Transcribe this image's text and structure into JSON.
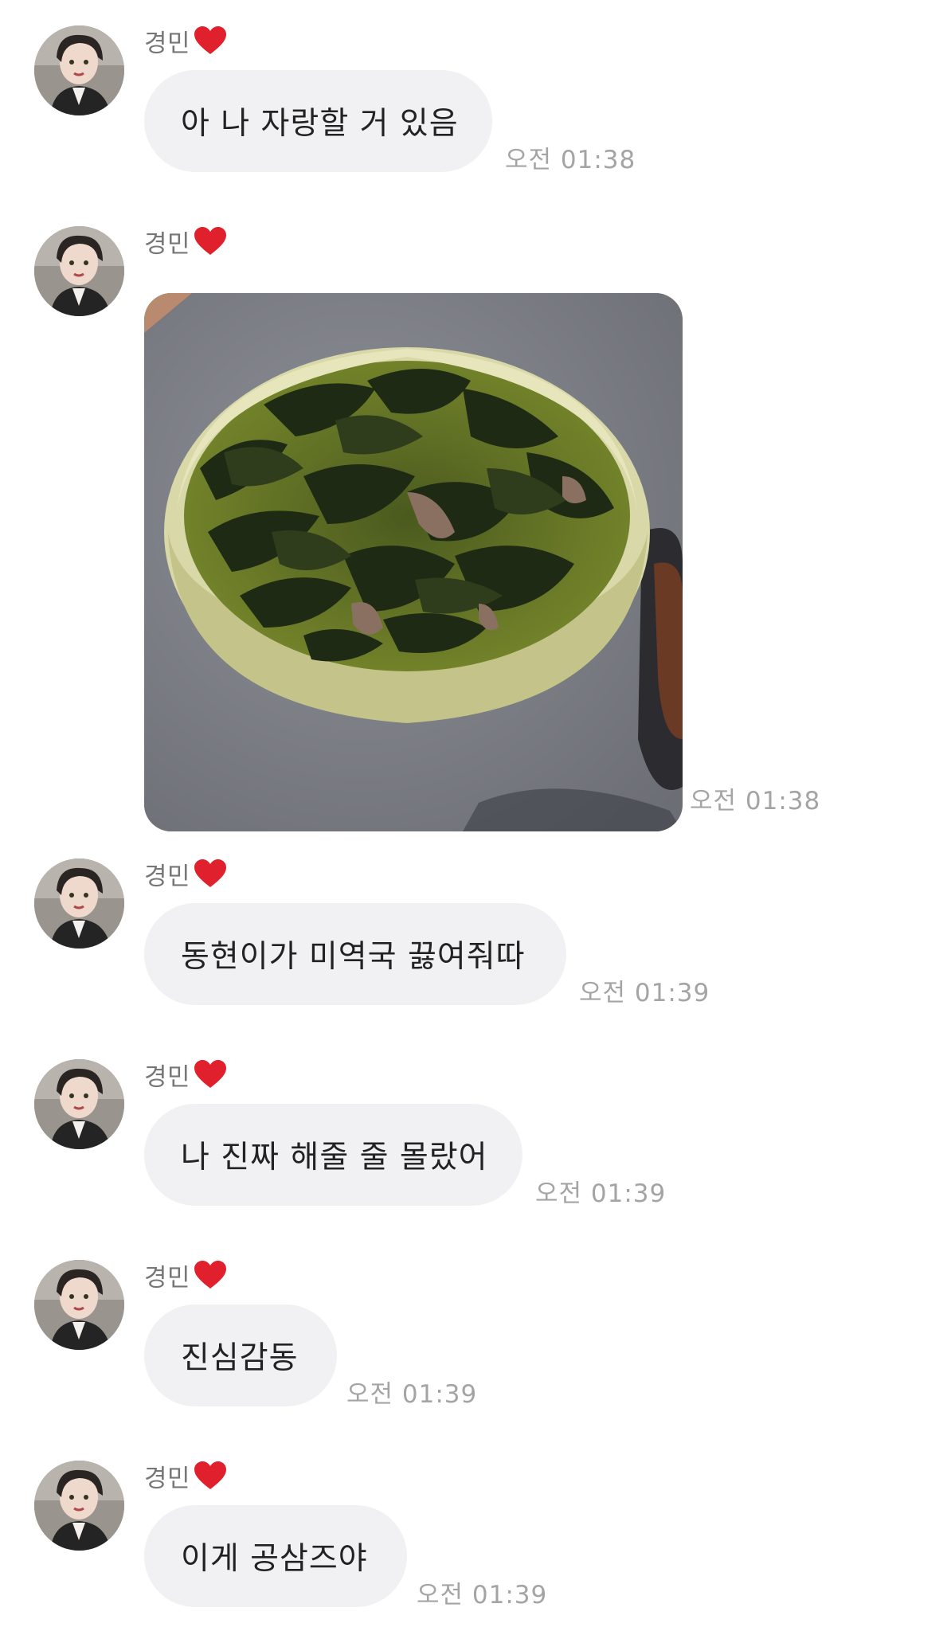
{
  "chat": {
    "messages": [
      {
        "sender": "경민",
        "text": "아 나 자랑할 거 있음",
        "time": "오전 01:38"
      },
      {
        "sender": "경민",
        "image": "seaweed-soup-photo",
        "time": "오전 01:38"
      },
      {
        "sender": "경민",
        "text": "동현이가 미역국 끓여줘따",
        "time": "오전 01:39"
      },
      {
        "sender": "경민",
        "text": "나 진짜 해줄 줄 몰랐어",
        "time": "오전 01:39"
      },
      {
        "sender": "경민",
        "text": "진심감동",
        "time": "오전 01:39"
      },
      {
        "sender": "경민",
        "text": "이게 공삼즈야",
        "time": "오전 01:39"
      }
    ]
  },
  "icons": {
    "sender_badge": "red-heart-icon",
    "avatar": "profile-photo-avatar"
  },
  "colors": {
    "bubble_bg": "#f1f1f3",
    "text": "#222222",
    "sender": "#777777",
    "time": "#a4a4a4",
    "heart": "#e0202c"
  }
}
